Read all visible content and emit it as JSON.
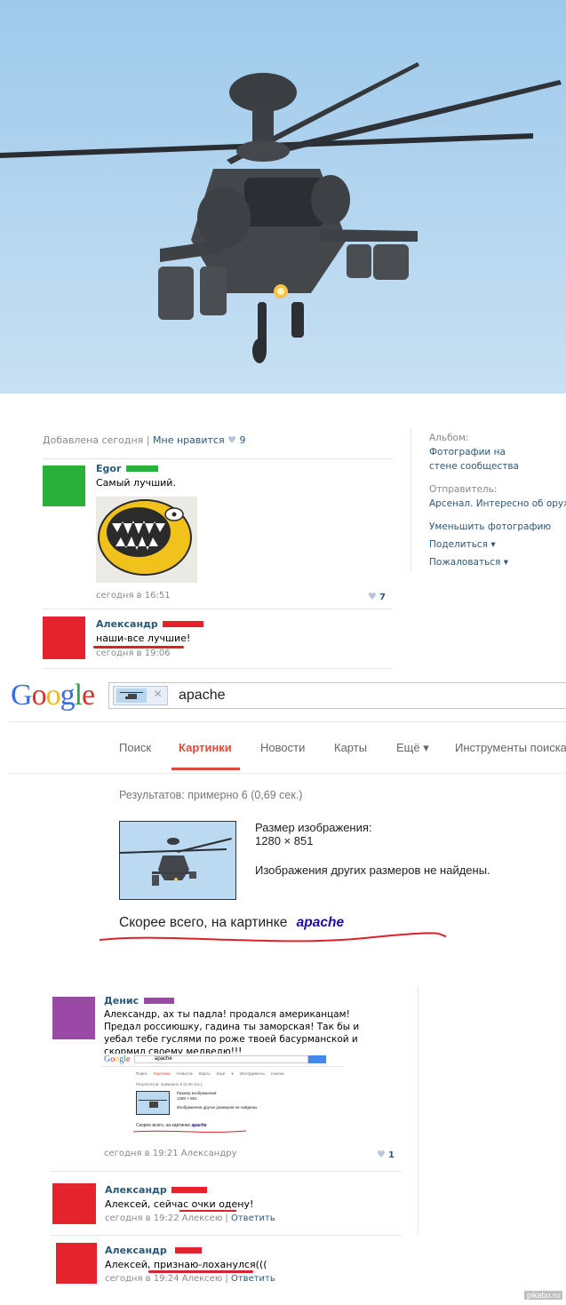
{
  "photo_meta": {
    "added": "Добавлена сегодня",
    "like_label": "Мне нравится",
    "like_count": "9"
  },
  "sidebar": {
    "album_label": "Альбом:",
    "album_value": "Фотографии на стене сообщества",
    "sender_label": "Отправитель:",
    "sender_value": "Арсенал. Интересно об оружи",
    "shrink": "Уменьшить фотографию",
    "share": "Поделиться",
    "report": "Пожаловаться"
  },
  "comments_top": [
    {
      "author": "Egor",
      "text": "Самый лучший.",
      "time": "сегодня в 16:51",
      "likes": "7"
    },
    {
      "author": "Александр",
      "text": "наши-все лучшие!",
      "time": "сегодня в 19:06"
    }
  ],
  "google": {
    "logo": "Google",
    "query": "apache",
    "tabs": [
      "Поиск",
      "Картинки",
      "Новости",
      "Карты",
      "Ещё ▾",
      "Инструменты поиска"
    ],
    "results": "Результатов: примерно 6 (0,69 сек.)",
    "size_label": "Размер изображения:",
    "size_value": "1280 × 851",
    "no_other": "Изображения других размеров не найдены.",
    "guess_label": "Скорее всего, на картинке",
    "guess_value": "apache"
  },
  "comments_bottom": [
    {
      "author": "Денис",
      "text": "Александр, ах ты падла! продался американцам! Предал россиюшку, гадина ты заморская! Так бы и уебал тебе гуслями по роже твоей басурманской и скормил своему медведю!!!",
      "time": "сегодня в 19:21 Александру",
      "likes": "1"
    },
    {
      "author": "Александр",
      "text": "Алексей, сейчас очки одену!",
      "time": "сегодня в 19:22 Алексею",
      "reply": "Ответить"
    },
    {
      "author": "Александр",
      "text": "Алексей, признаю-лоханулся(((",
      "time": "сегодня в 19:24 Алексею",
      "reply": "Ответить"
    }
  ],
  "mini": {
    "logo": "Google",
    "query": "apache",
    "tabs": [
      "Поиск",
      "Картинки",
      "Новости",
      "Карты",
      "Ещё ▾",
      "Инструменты поиска"
    ],
    "results": "Результатов: примерно 6 (0,69 сек.)",
    "size_label": "Размер изображения:",
    "size_value": "1280 × 851",
    "no_other": "Изображения других размеров не найдены.",
    "guess_label": "Скорее всего, на картинке",
    "guess_value": "apache"
  },
  "watermark": "pikabu.ru",
  "colors": {
    "vk_link": "#2b587a",
    "redact": "#e5232c",
    "google_red": "#dd4b39"
  }
}
